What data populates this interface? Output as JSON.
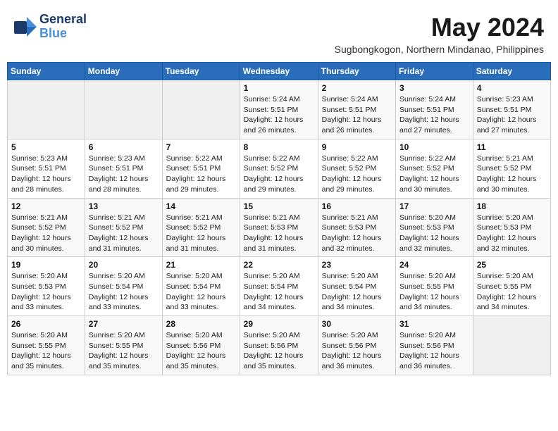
{
  "logo": {
    "brand": "General",
    "brand2": "Blue",
    "tagline": ""
  },
  "header": {
    "title": "May 2024",
    "subtitle": "Sugbongkogon, Northern Mindanao, Philippines"
  },
  "weekdays": [
    "Sunday",
    "Monday",
    "Tuesday",
    "Wednesday",
    "Thursday",
    "Friday",
    "Saturday"
  ],
  "weeks": [
    [
      {
        "day": "",
        "info": ""
      },
      {
        "day": "",
        "info": ""
      },
      {
        "day": "",
        "info": ""
      },
      {
        "day": "1",
        "info": "Sunrise: 5:24 AM\nSunset: 5:51 PM\nDaylight: 12 hours\nand 26 minutes."
      },
      {
        "day": "2",
        "info": "Sunrise: 5:24 AM\nSunset: 5:51 PM\nDaylight: 12 hours\nand 26 minutes."
      },
      {
        "day": "3",
        "info": "Sunrise: 5:24 AM\nSunset: 5:51 PM\nDaylight: 12 hours\nand 27 minutes."
      },
      {
        "day": "4",
        "info": "Sunrise: 5:23 AM\nSunset: 5:51 PM\nDaylight: 12 hours\nand 27 minutes."
      }
    ],
    [
      {
        "day": "5",
        "info": "Sunrise: 5:23 AM\nSunset: 5:51 PM\nDaylight: 12 hours\nand 28 minutes."
      },
      {
        "day": "6",
        "info": "Sunrise: 5:23 AM\nSunset: 5:51 PM\nDaylight: 12 hours\nand 28 minutes."
      },
      {
        "day": "7",
        "info": "Sunrise: 5:22 AM\nSunset: 5:51 PM\nDaylight: 12 hours\nand 29 minutes."
      },
      {
        "day": "8",
        "info": "Sunrise: 5:22 AM\nSunset: 5:52 PM\nDaylight: 12 hours\nand 29 minutes."
      },
      {
        "day": "9",
        "info": "Sunrise: 5:22 AM\nSunset: 5:52 PM\nDaylight: 12 hours\nand 29 minutes."
      },
      {
        "day": "10",
        "info": "Sunrise: 5:22 AM\nSunset: 5:52 PM\nDaylight: 12 hours\nand 30 minutes."
      },
      {
        "day": "11",
        "info": "Sunrise: 5:21 AM\nSunset: 5:52 PM\nDaylight: 12 hours\nand 30 minutes."
      }
    ],
    [
      {
        "day": "12",
        "info": "Sunrise: 5:21 AM\nSunset: 5:52 PM\nDaylight: 12 hours\nand 30 minutes."
      },
      {
        "day": "13",
        "info": "Sunrise: 5:21 AM\nSunset: 5:52 PM\nDaylight: 12 hours\nand 31 minutes."
      },
      {
        "day": "14",
        "info": "Sunrise: 5:21 AM\nSunset: 5:52 PM\nDaylight: 12 hours\nand 31 minutes."
      },
      {
        "day": "15",
        "info": "Sunrise: 5:21 AM\nSunset: 5:53 PM\nDaylight: 12 hours\nand 31 minutes."
      },
      {
        "day": "16",
        "info": "Sunrise: 5:21 AM\nSunset: 5:53 PM\nDaylight: 12 hours\nand 32 minutes."
      },
      {
        "day": "17",
        "info": "Sunrise: 5:20 AM\nSunset: 5:53 PM\nDaylight: 12 hours\nand 32 minutes."
      },
      {
        "day": "18",
        "info": "Sunrise: 5:20 AM\nSunset: 5:53 PM\nDaylight: 12 hours\nand 32 minutes."
      }
    ],
    [
      {
        "day": "19",
        "info": "Sunrise: 5:20 AM\nSunset: 5:53 PM\nDaylight: 12 hours\nand 33 minutes."
      },
      {
        "day": "20",
        "info": "Sunrise: 5:20 AM\nSunset: 5:54 PM\nDaylight: 12 hours\nand 33 minutes."
      },
      {
        "day": "21",
        "info": "Sunrise: 5:20 AM\nSunset: 5:54 PM\nDaylight: 12 hours\nand 33 minutes."
      },
      {
        "day": "22",
        "info": "Sunrise: 5:20 AM\nSunset: 5:54 PM\nDaylight: 12 hours\nand 34 minutes."
      },
      {
        "day": "23",
        "info": "Sunrise: 5:20 AM\nSunset: 5:54 PM\nDaylight: 12 hours\nand 34 minutes."
      },
      {
        "day": "24",
        "info": "Sunrise: 5:20 AM\nSunset: 5:55 PM\nDaylight: 12 hours\nand 34 minutes."
      },
      {
        "day": "25",
        "info": "Sunrise: 5:20 AM\nSunset: 5:55 PM\nDaylight: 12 hours\nand 34 minutes."
      }
    ],
    [
      {
        "day": "26",
        "info": "Sunrise: 5:20 AM\nSunset: 5:55 PM\nDaylight: 12 hours\nand 35 minutes."
      },
      {
        "day": "27",
        "info": "Sunrise: 5:20 AM\nSunset: 5:55 PM\nDaylight: 12 hours\nand 35 minutes."
      },
      {
        "day": "28",
        "info": "Sunrise: 5:20 AM\nSunset: 5:56 PM\nDaylight: 12 hours\nand 35 minutes."
      },
      {
        "day": "29",
        "info": "Sunrise: 5:20 AM\nSunset: 5:56 PM\nDaylight: 12 hours\nand 35 minutes."
      },
      {
        "day": "30",
        "info": "Sunrise: 5:20 AM\nSunset: 5:56 PM\nDaylight: 12 hours\nand 36 minutes."
      },
      {
        "day": "31",
        "info": "Sunrise: 5:20 AM\nSunset: 5:56 PM\nDaylight: 12 hours\nand 36 minutes."
      },
      {
        "day": "",
        "info": ""
      }
    ]
  ]
}
